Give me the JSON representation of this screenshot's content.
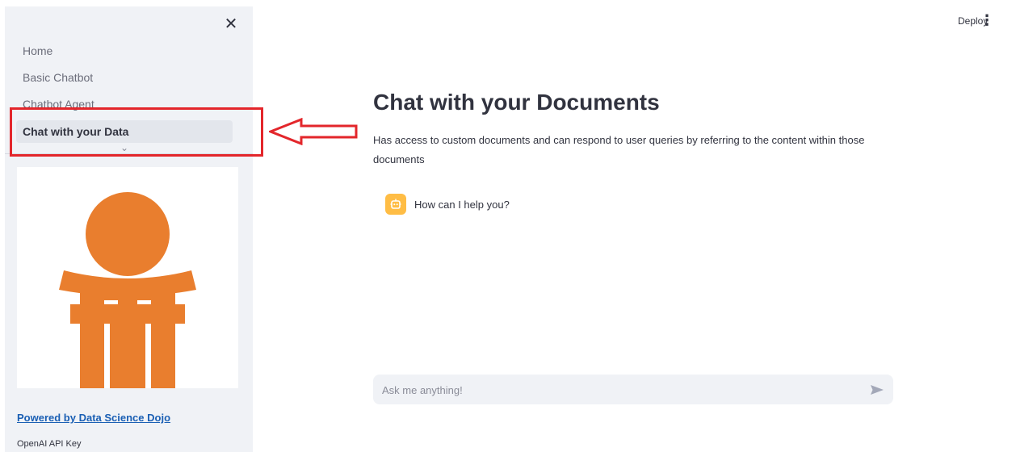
{
  "sidebar": {
    "close_icon": "close-icon",
    "nav_items": [
      {
        "label": "Home"
      },
      {
        "label": "Basic Chatbot"
      },
      {
        "label": "Chatbot Agent"
      },
      {
        "label": "Chat with your Data"
      }
    ],
    "active_index": 3,
    "expand_icon": "chevron-down-icon",
    "logo": {
      "name": "data-science-dojo-logo",
      "color": "#e97e2e"
    },
    "powered_by": "Powered by Data Science Dojo",
    "api_key_label": "OpenAI API Key"
  },
  "topbar": {
    "deploy_label": "Deploy",
    "menu_icon": "kebab-menu-icon"
  },
  "annotation": {
    "box_color": "#e3262b",
    "arrow_icon": "left-arrow-icon"
  },
  "main": {
    "title": "Chat with your Documents",
    "description": "Has access to custom documents and can respond to user queries by referring to the content within those documents",
    "messages": [
      {
        "role": "assistant",
        "avatar_icon": "robot-icon",
        "text": "How can I help you?"
      }
    ],
    "chat_input": {
      "placeholder": "Ask me anything!",
      "value": "",
      "send_icon": "send-icon"
    }
  },
  "colors": {
    "sidebar_bg": "#f0f2f6",
    "avatar_bg": "#ffbd45",
    "link": "#1a5fb4"
  }
}
